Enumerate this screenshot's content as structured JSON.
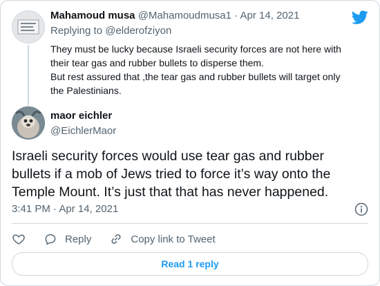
{
  "colors": {
    "accent": "#1d9bf0",
    "muted": "#536471",
    "text": "#0f1419",
    "border": "#cfd9de"
  },
  "parent_tweet": {
    "name": "Mahamoud musa",
    "handle": "@Mahamoudmusa1",
    "separator": "·",
    "date": "Apr 14, 2021",
    "replying_prefix": "Replying to",
    "replying_to": "@elderofziyon",
    "text_lines": [
      "They must be lucky because Israeli security forces are not here with their tear gas and rubber bullets to disperse them.",
      "But rest assured that ,the tear gas and rubber bullets will target only the Palestinians."
    ]
  },
  "main_tweet": {
    "name": "maor eichler",
    "handle": "@EichlerMaor",
    "text": "Israeli security forces would use tear gas and rubber bullets if a mob of Jews tried to force it’s way onto the Temple Mount. It’s just that that has never happened.",
    "time": "3:41 PM",
    "separator": "·",
    "date": "Apr 14, 2021"
  },
  "actions": {
    "like_icon": "heart-icon",
    "reply_label": "Reply",
    "copy_link_label": "Copy link to Tweet"
  },
  "read_replies_label": "Read 1 reply",
  "icons": {
    "brand": "twitter-bird-icon",
    "info": "info-icon"
  }
}
